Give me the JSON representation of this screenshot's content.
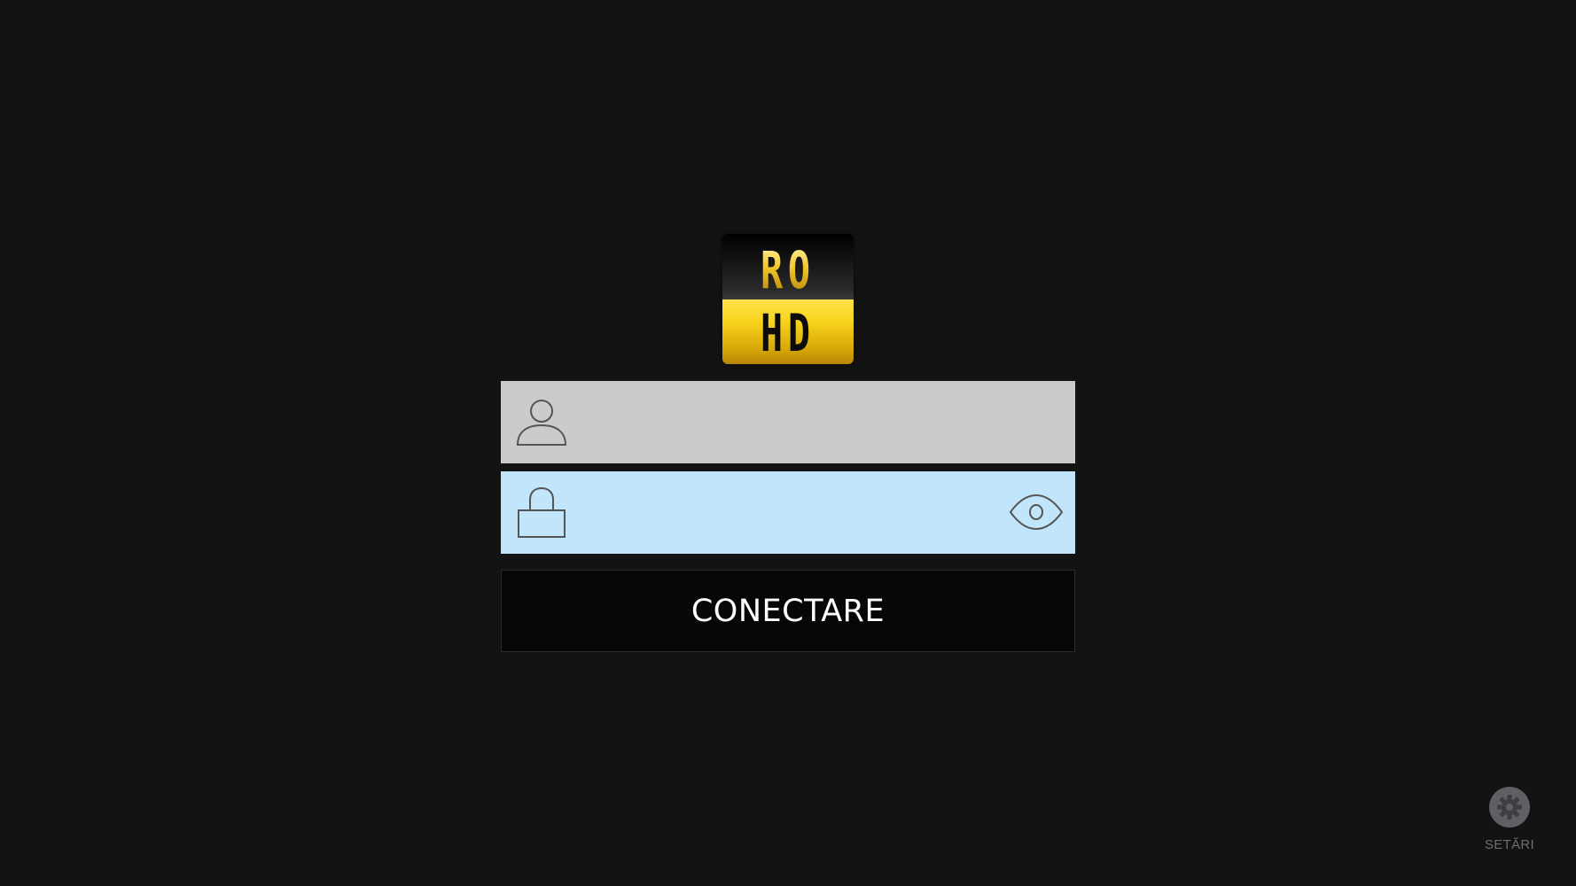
{
  "logo": {
    "top_text": "RO",
    "bottom_text": "HD"
  },
  "username": {
    "value": "",
    "icon": "user-icon"
  },
  "password": {
    "value": "",
    "icon": "lock-icon",
    "toggle_icon": "eye-icon"
  },
  "connect_button": {
    "label": "CONECTARE"
  },
  "settings": {
    "label": "SETĂRI",
    "icon": "gear-icon"
  },
  "colors": {
    "background": "#131314",
    "username_field": "#cacbcd",
    "password_field": "#c1e6fb",
    "button": "#070709",
    "logo_gold": "#f7d31c"
  }
}
